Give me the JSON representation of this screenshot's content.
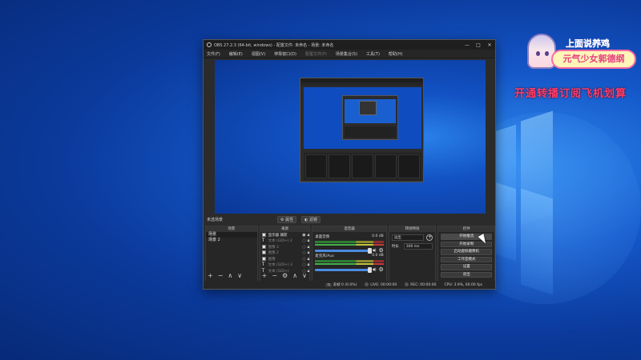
{
  "overlay": {
    "sticker_line1": "上面说养鸡",
    "sticker_line2": "元气少女郭德纲",
    "promo": "开通转播订阅飞机划算"
  },
  "window": {
    "title": "OBS 27.2.3 (64-bit, windows) - 配置文件: 未命名 - 场景: 未命名",
    "controls": [
      "—",
      "□",
      "✕"
    ]
  },
  "menu": [
    {
      "label": "文件(F)",
      "enabled": true
    },
    {
      "label": "编辑(E)",
      "enabled": true
    },
    {
      "label": "视图(V)",
      "enabled": true
    },
    {
      "label": "停靠窗口(D)",
      "enabled": true
    },
    {
      "label": "配置文件(P)",
      "enabled": false
    },
    {
      "label": "场景集合(S)",
      "enabled": true
    },
    {
      "label": "工具(T)",
      "enabled": true
    },
    {
      "label": "帮助(H)",
      "enabled": true
    }
  ],
  "nav": {
    "no_scene": "未选场景",
    "properties": "属性",
    "filters": "滤镜"
  },
  "docks": {
    "scenes": {
      "header": "场景",
      "items": [
        "场景",
        "场景 2"
      ]
    },
    "sources": {
      "header": "来源",
      "items": [
        {
          "icon": "▣",
          "name": "显示器 捕获",
          "dim": false
        },
        {
          "icon": "T",
          "name": "文本 (GDI+) 2",
          "dim": true
        },
        {
          "icon": "▣",
          "name": "图像 3",
          "dim": true
        },
        {
          "icon": "▣",
          "name": "图像 2",
          "dim": true
        },
        {
          "icon": "▣",
          "name": "图像",
          "dim": true
        },
        {
          "icon": "T",
          "name": "文本 (GDI+) 3",
          "dim": true
        },
        {
          "icon": "T",
          "name": "文本 (GDI+)",
          "dim": true
        }
      ]
    },
    "mixer": {
      "header": "混音器",
      "channels": [
        {
          "name": "桌面音频",
          "db": "0.0 dB"
        },
        {
          "name": "麦克风/Aux",
          "db": "0.0 dB"
        }
      ]
    },
    "transitions": {
      "header": "转场特效",
      "selected": "淡出",
      "duration_label": "时长",
      "duration": "300 ms"
    },
    "controls": {
      "header": "控件",
      "buttons": [
        "开始推流",
        "开始录制",
        "启动虚拟摄像机",
        "工作室模式",
        "设置",
        "退出"
      ]
    }
  },
  "status": {
    "dropped": "丢帧 0 (0.0%)",
    "live": "LIVE: 00:00:00",
    "rec": "REC: 00:00:00",
    "cpu": "CPU: 3.9%, 60.00 fps"
  }
}
